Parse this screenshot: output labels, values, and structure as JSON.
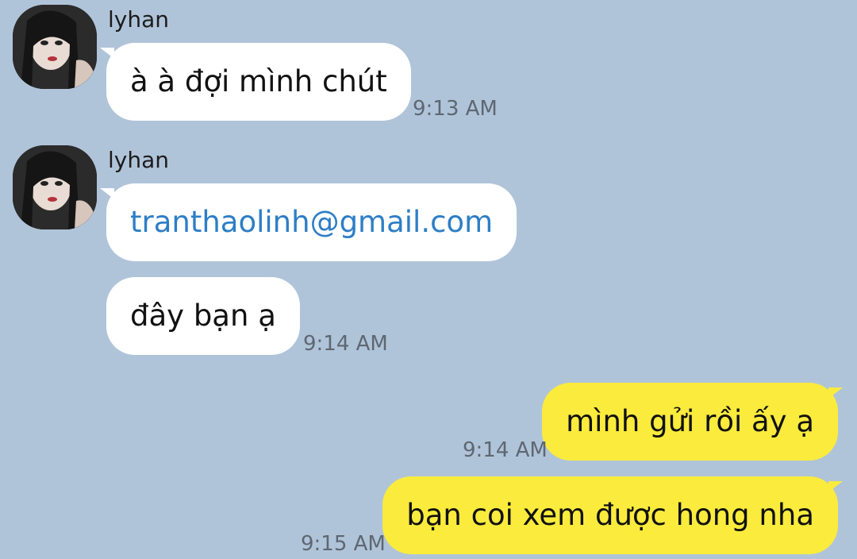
{
  "chat": {
    "contact": "lyhan",
    "groups": [
      {
        "sender": "lyhan",
        "messages": [
          {
            "text": "à à đợi mình chút",
            "time": "9:13 AM"
          }
        ]
      },
      {
        "sender": "lyhan",
        "messages": [
          {
            "text": "tranthaolinh@gmail.com",
            "is_link": true
          },
          {
            "text": "đây bạn ạ",
            "time": "9:14 AM"
          }
        ]
      }
    ],
    "outgoing": [
      {
        "text": "mình gửi rồi ấy ạ",
        "time": "9:14 AM"
      },
      {
        "text": "bạn coi xem được hong nha",
        "time": "9:15 AM"
      }
    ]
  },
  "colors": {
    "background": "#b0c4d9",
    "incoming_bubble": "#ffffff",
    "outgoing_bubble": "#fbeb3c",
    "link": "#2d7ec6",
    "timestamp": "#5e6772"
  },
  "icons": {
    "avatar": "profile-photo"
  }
}
